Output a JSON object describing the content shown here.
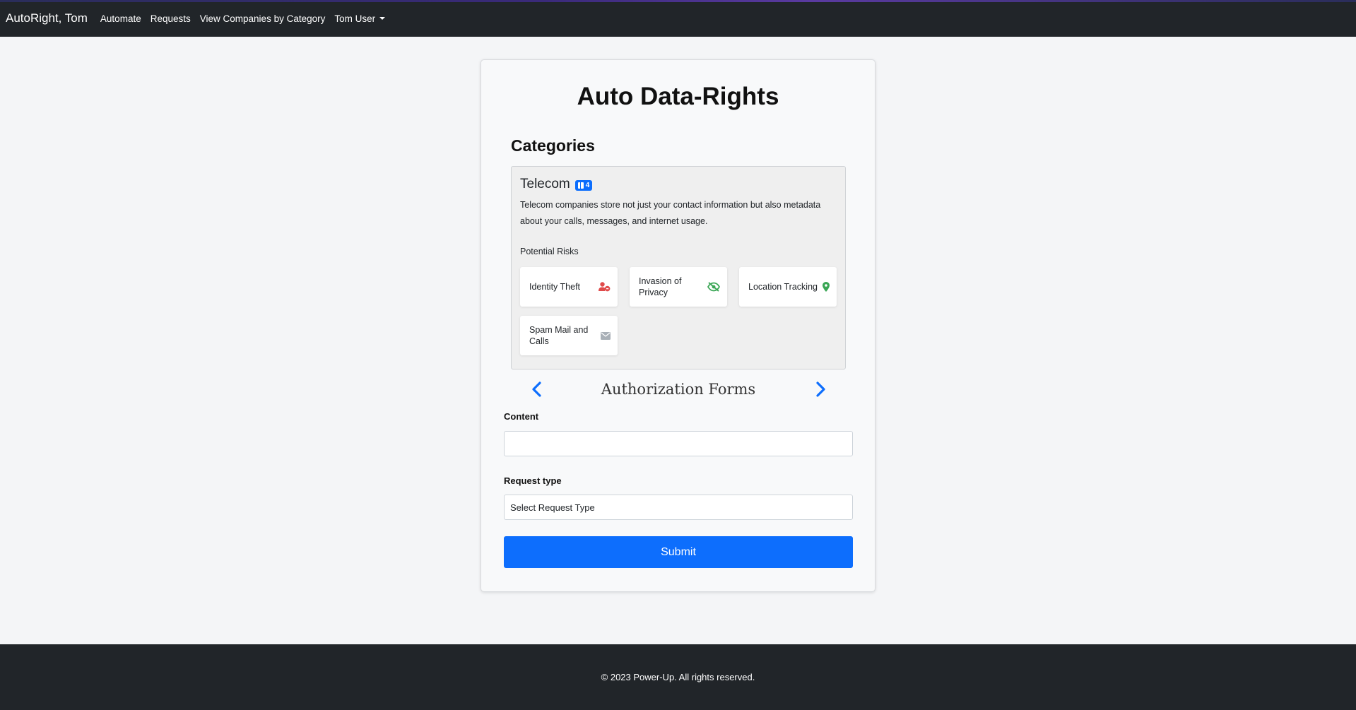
{
  "navbar": {
    "brand": "AutoRight, Tom",
    "links": [
      "Automate",
      "Requests",
      "View Companies by Category"
    ],
    "user_menu": "Tom User"
  },
  "page": {
    "title": "Auto Data-Rights",
    "categories_heading": "Categories"
  },
  "category": {
    "name": "Telecom",
    "badge_count": "4",
    "description": "Telecom companies store not just your contact information but also metadata about your calls, messages, and internet usage.",
    "risks_label": "Potential Risks",
    "risks": [
      {
        "label": "Identity Theft",
        "icon": "user-shield-icon",
        "color": "#e04b4b"
      },
      {
        "label": "Invasion of Privacy",
        "icon": "eye-slash-icon",
        "color": "#3aa655"
      },
      {
        "label": "Location Tracking",
        "icon": "map-marker-icon",
        "color": "#3aa655"
      },
      {
        "label": "Spam Mail and Calls",
        "icon": "envelope-icon",
        "color": "#a9b0b7"
      }
    ]
  },
  "auth": {
    "title": "Authorization Forms"
  },
  "form": {
    "content_label": "Content",
    "content_value": "",
    "request_type_label": "Request type",
    "request_type_value": "Select Request Type",
    "submit_label": "Submit"
  },
  "footer": {
    "text": "© 2023 Power-Up. All rights reserved."
  },
  "colors": {
    "navbar": "#212529",
    "primary": "#0d6efd",
    "card_bg": "#f8f9fa",
    "page_bg": "#f4f5f7"
  }
}
